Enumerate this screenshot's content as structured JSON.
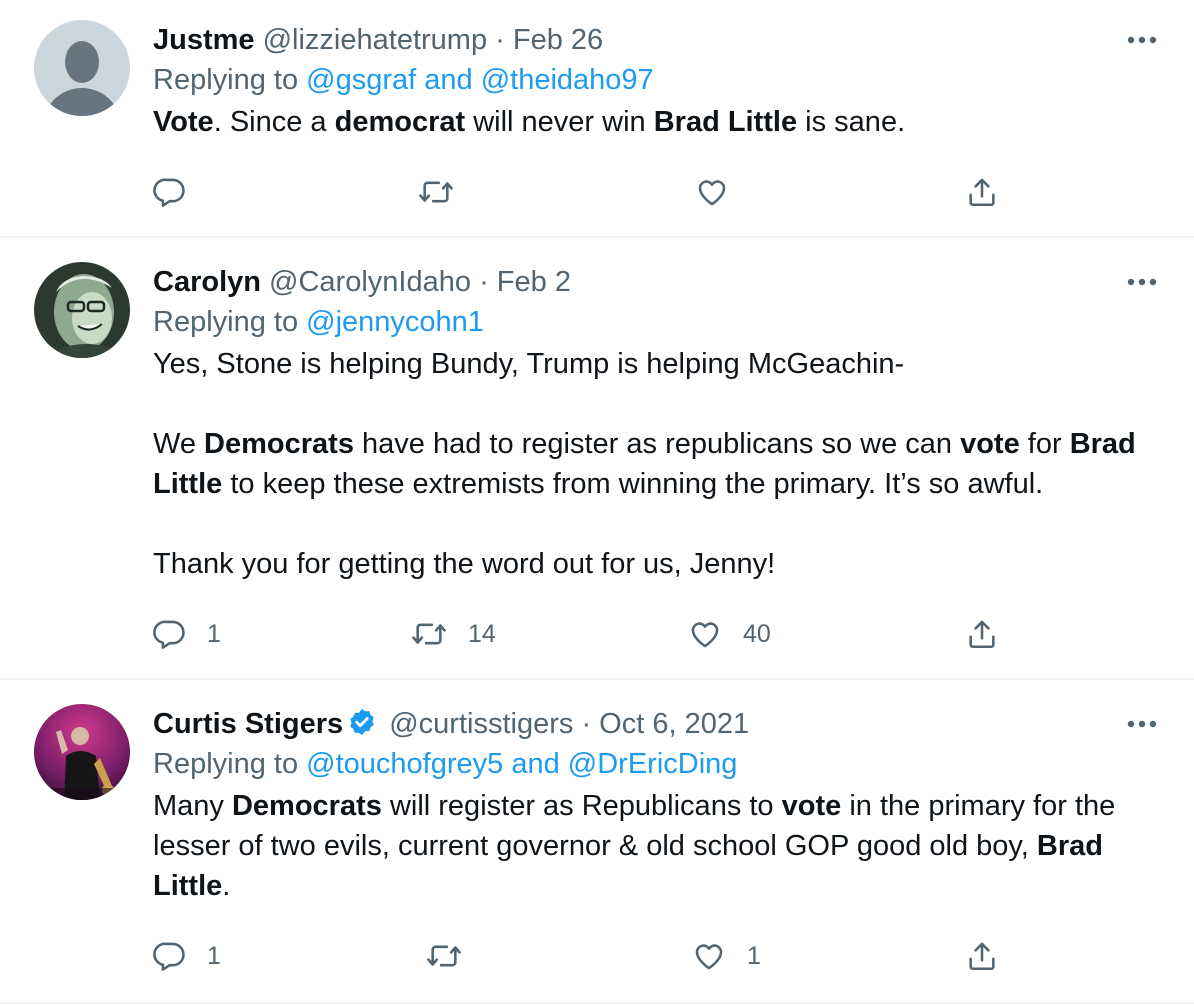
{
  "tweets": [
    {
      "name": "Justme",
      "handle": "@lizziehatetrump",
      "dot": "·",
      "date": "Feb 26",
      "replying_prefix": "Replying to",
      "mention1": "@gsgraf",
      "and": "and",
      "mention2": "@theidaho97",
      "body": {
        "s1": "Vote",
        "s2": ". Since a ",
        "s3": "democrat",
        "s4": " will never win ",
        "s5": "Brad Little",
        "s6": " is sane."
      },
      "counts": {
        "reply": "",
        "retweet": "",
        "like": ""
      }
    },
    {
      "name": "Carolyn",
      "handle": "@CarolynIdaho",
      "dot": "·",
      "date": "Feb 2",
      "replying_prefix": "Replying to",
      "mention1": "@jennycohn1",
      "body": {
        "p1": "Yes, Stone is helping Bundy, Trump is helping McGeachin-",
        "p2a": "We ",
        "p2b": "Democrats",
        "p2c": " have had to register as republicans so we can ",
        "p2d": "vote",
        "p2e": " for ",
        "p2f": "Brad Little",
        "p2g": " to keep these extremists from winning the primary. It’s so awful.",
        "p3": "Thank you for getting the word out for us, Jenny!"
      },
      "counts": {
        "reply": "1",
        "retweet": "14",
        "like": "40"
      }
    },
    {
      "name": "Curtis Stigers",
      "handle": "@curtisstigers",
      "dot": "·",
      "date": "Oct 6, 2021",
      "replying_prefix": "Replying to",
      "mention1": "@touchofgrey5",
      "and": "and",
      "mention2": "@DrEricDing",
      "body": {
        "s1": "Many ",
        "s2": "Democrats",
        "s3": " will register as Republicans to ",
        "s4": "vote",
        "s5": " in the primary for the lesser of two evils, current governor & old school GOP good old boy, ",
        "s6": "Brad Little",
        "s7": "."
      },
      "counts": {
        "reply": "1",
        "retweet": "",
        "like": "1"
      }
    }
  ],
  "icons": {
    "more": "more-horizontal-icon",
    "reply": "reply-bubble-icon",
    "retweet": "retweet-icon",
    "like": "heart-icon",
    "share": "share-upload-icon",
    "verified": "verified-badge-icon"
  },
  "colors": {
    "text": "#0f1419",
    "secondary": "#536471",
    "link": "#1d9bf0",
    "divider": "#eff3f4"
  }
}
